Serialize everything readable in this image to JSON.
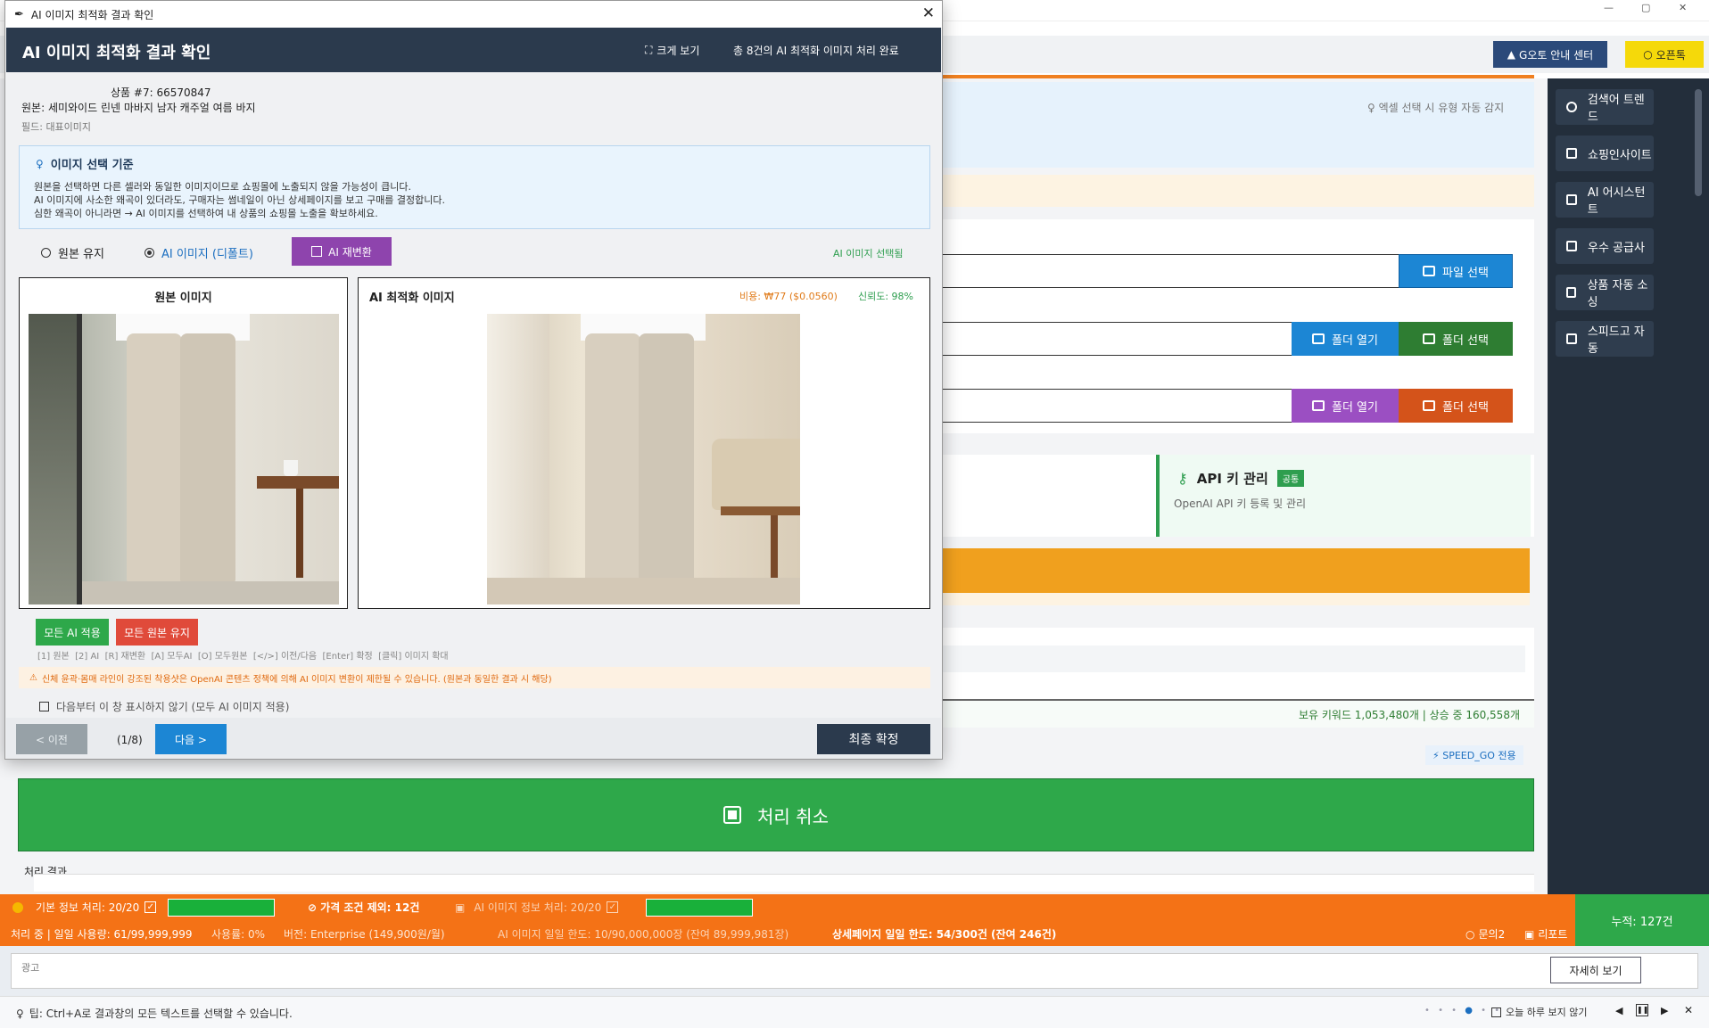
{
  "background_app": {
    "header_buttons": {
      "guide": "G오토 안내 센터",
      "open_chat": "오픈톡"
    },
    "hint_excel": "엑셀 선택 시 유형 자동 감지",
    "buttons": {
      "file_select": "파일 선택",
      "folder_open_1": "폴더 열기",
      "folder_select_1": "폴더 선택",
      "folder_open_2": "폴더 열기",
      "folder_select_2": "폴더 선택"
    },
    "api_card": {
      "title": "API 키 관리",
      "badge": "공통",
      "desc": "OpenAI API 키 등록 및 관리"
    },
    "keyword_stats": "보유 키워드 1,053,480개 | 상승 중 160,558개",
    "speedgo_badge": "SPEED_GO 전용",
    "cancel_button": "처리 취소",
    "result_label": "처리 결과",
    "sidebar": [
      "검색어 트렌드",
      "쇼핑인사이트",
      "AI 어시스턴트",
      "우수 공급사",
      "상품 자동 소싱",
      "스피드고 자동"
    ]
  },
  "status_bar": {
    "basic_info": "기본 정보 처리: 20/20",
    "price_exclude": "가격 조건 제외: 12건",
    "ai_info": "AI 이미지 정보 처리: 20/20",
    "line2_left": "처리 중 | 일일 사용량: 61/99,999,999",
    "usage": "사용률: 0%",
    "version": "버전: Enterprise (149,900원/월)",
    "ai_limit": "AI 이미지 일일 한도: 10/90,000,000장 (잔여 89,999,981장)",
    "detail_limit": "상세페이지 일일 한도: 54/300건 (잔여 246건)",
    "inquiry": "문의2",
    "report": "리포트",
    "total": "누적: 127건"
  },
  "ad": {
    "label": "광고",
    "detail_button": "자세히 보기"
  },
  "tip_bar": {
    "tip": "팁: Ctrl+A로 결과창의 모든 텍스트를 선택할 수 있습니다.",
    "hide_today": "오늘 하루 보지 않기"
  },
  "dialog": {
    "window_title": "AI 이미지 최적화 결과 확인",
    "title": "AI 이미지 최적화 결과 확인",
    "enlarge": "크게 보기",
    "summary": "총 8건의 AI 최적화 이미지 처리 완료",
    "product_no": "상품 #7: 66570847",
    "original_name": "원본: 세미와이드 린넨 마바지 남자 캐주얼 여름 바지",
    "field": "필드: 대표이미지",
    "criteria": {
      "title": "이미지 선택 기준",
      "lines": [
        "원본을 선택하면 다른 셀러와 동일한 이미지이므로 쇼핑몰에 노출되지 않을 가능성이 큽니다.",
        "AI 이미지에 사소한 왜곡이 있더라도, 구매자는 썸네일이 아닌 상세페이지를 보고 구매를 결정합니다.",
        "심한 왜곡이 아니라면 → AI 이미지를 선택하여 내 상품의 쇼핑몰 노출을 확보하세요."
      ]
    },
    "radio_keep": "원본 유지",
    "radio_ai": "AI 이미지 (디폴트)",
    "reconvert": "AI 재변환",
    "selected_status": "AI 이미지 선택됨",
    "original_panel": "원본 이미지",
    "ai_panel": "AI 최적화 이미지",
    "cost": "비용: ₩77 ($0.0560)",
    "confidence": "신뢰도: 98%",
    "all_ai": "모든 AI 적용",
    "all_keep": "모든 원본 유지",
    "shortcuts": "[1] 원본  [2] AI  [R] 재변환  [A] 모두AI  [O] 모두원본  [</>] 이전/다음  [Enter] 확정  [클릭] 이미지 확대",
    "warning": "신체 윤곽·몸매 라인이 강조된 착용샷은 OpenAI 콘텐츠 정책에 의해 AI 이미지 변환이 제한될 수 있습니다. (원본과 동일한 결과 시 해당)",
    "dont_show": "다음부터 이 창 표시하지 않기 (모두 AI 이미지 적용)",
    "prev": "< 이전",
    "page": "(1/8)",
    "next": "다음 >",
    "confirm": "최종 확정"
  }
}
